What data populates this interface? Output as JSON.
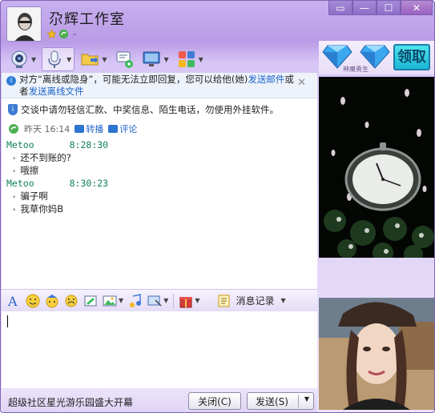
{
  "window": {
    "nickname": "尕辉工作室",
    "signature": "-",
    "controls": [
      "▭",
      "—",
      "☐",
      "✕"
    ]
  },
  "notice": {
    "text_before": "对方“离线或隐身”，可能无法立即回复，您可以给他(她)",
    "link_mail": "发送邮件",
    "text_mid": "或者",
    "link_file": "发送离线文件",
    "close": "✕"
  },
  "chat": {
    "security_text": "交谈中请勿轻信汇款、中奖信息、陌生电话，勿使用外挂软件。",
    "feed": {
      "time": "昨天 16:14",
      "forward": "转播",
      "comment": "评论"
    },
    "messages": [
      {
        "sender": "Metoo",
        "time": "8:28:30",
        "lines": [
          "还不到账的?",
          "哦擦"
        ]
      },
      {
        "sender": "Metoo",
        "time": "8:30:23",
        "lines": [
          "骗子啊",
          "我草你妈B"
        ]
      }
    ]
  },
  "input_toolbar": {
    "history_label": "消息记录"
  },
  "bottom": {
    "ad_text": "超级社区星光游乐园盛大开幕",
    "close_label": "关闭(C)",
    "send_label": "发送(S)"
  },
  "ad_panel": {
    "get_label": "领取",
    "caption": "神魔勇生"
  },
  "colors": {
    "accent": "#9b7fd4",
    "link": "#1d63c8",
    "sender": "#10805e"
  }
}
